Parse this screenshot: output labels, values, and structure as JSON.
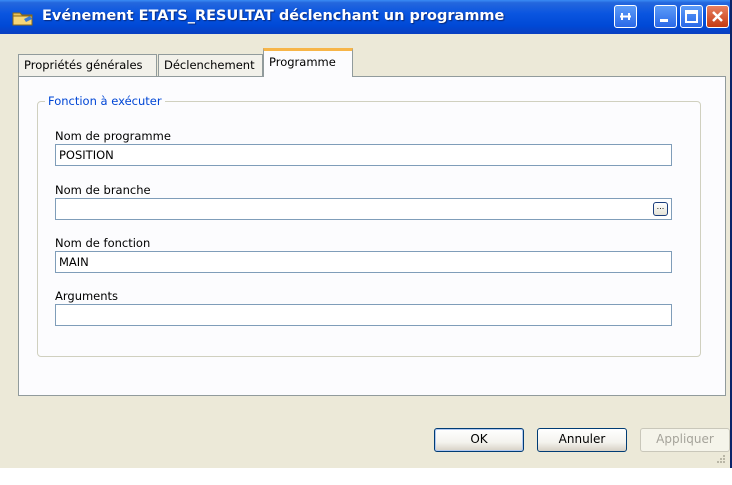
{
  "window": {
    "title": "Evénement ETATS_RESULTAT déclenchant un programme",
    "icon": "folder-icon"
  },
  "title_buttons": [
    "pin-icon",
    "minimize-icon",
    "maximize-icon",
    "close-icon"
  ],
  "tabs": [
    {
      "label": "Propriétés générales",
      "active": false
    },
    {
      "label": "Déclenchement",
      "active": false
    },
    {
      "label": "Programme",
      "active": true
    }
  ],
  "group": {
    "legend": "Fonction à exécuter",
    "fields": {
      "program": {
        "label": "Nom de programme",
        "value": "POSITION"
      },
      "branch": {
        "label": "Nom de branche",
        "value": "",
        "browse_label": "..."
      },
      "function": {
        "label": "Nom de fonction",
        "value": "MAIN"
      },
      "arguments": {
        "label": "Arguments",
        "value": ""
      }
    }
  },
  "buttons": {
    "ok": "OK",
    "cancel": "Annuler",
    "apply": "Appliquer"
  },
  "colors": {
    "titlebar": "#0a55e0",
    "legend_text": "#0046d5",
    "active_tab_accent": "#f7b548"
  }
}
